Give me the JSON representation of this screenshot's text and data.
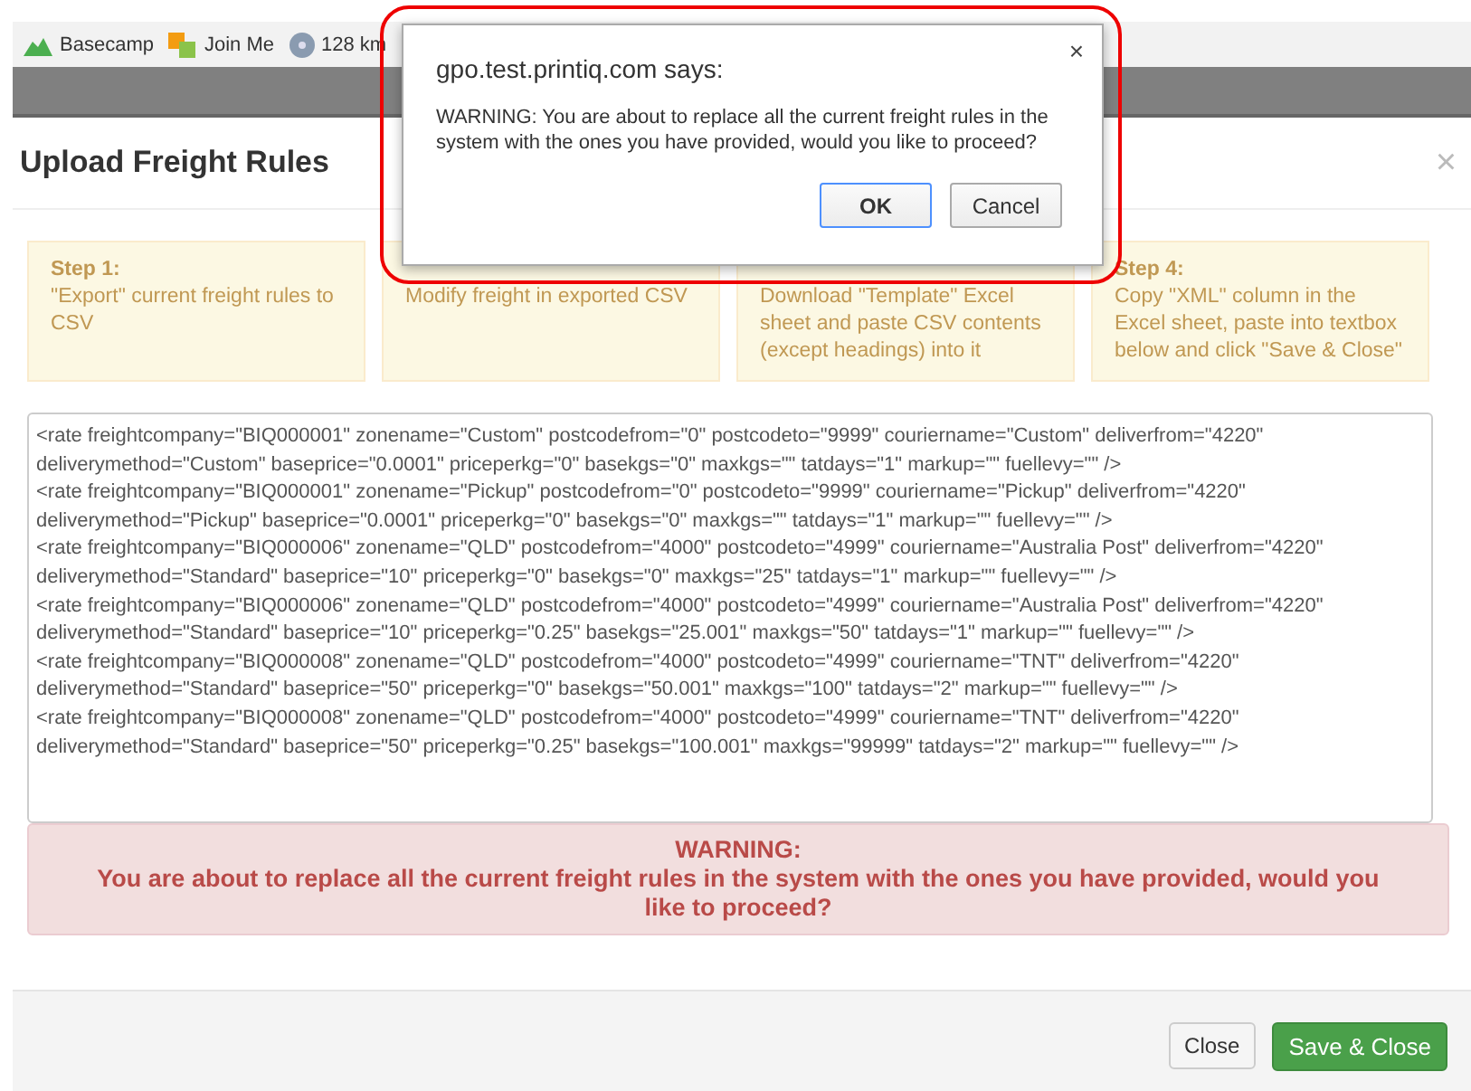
{
  "bookmarks": [
    {
      "label": "Basecamp",
      "kind": "mountain"
    },
    {
      "label": "Join Me",
      "kind": "squares"
    },
    {
      "label": "128 km",
      "kind": "disc"
    }
  ],
  "modal": {
    "title": "Upload Freight Rules",
    "close": "×",
    "steps": [
      {
        "heading": "Step 1:",
        "text": "\"Export\" current freight rules to CSV"
      },
      {
        "text": "Modify freight in exported CSV"
      },
      {
        "text": "Download \"Template\" Excel sheet and paste CSV contents (except headings) into it"
      },
      {
        "heading": "Step 4:",
        "text": "Copy \"XML\" column in the Excel sheet, paste into textbox below and click \"Save & Close\""
      }
    ],
    "xml_lines": [
      "<rate freightcompany=\"BIQ000001\" zonename=\"Custom\" postcodefrom=\"0\" postcodeto=\"9999\" couriername=\"Custom\" deliverfrom=\"4220\"",
      "deliverymethod=\"Custom\" baseprice=\"0.0001\" priceperkg=\"0\" basekgs=\"0\" maxkgs=\"\" tatdays=\"1\" markup=\"\" fuellevy=\"\" />",
      "<rate freightcompany=\"BIQ000001\" zonename=\"Pickup\" postcodefrom=\"0\" postcodeto=\"9999\" couriername=\"Pickup\" deliverfrom=\"4220\"",
      "deliverymethod=\"Pickup\" baseprice=\"0.0001\" priceperkg=\"0\" basekgs=\"0\" maxkgs=\"\" tatdays=\"1\" markup=\"\" fuellevy=\"\" />",
      "<rate freightcompany=\"BIQ000006\" zonename=\"QLD\" postcodefrom=\"4000\" postcodeto=\"4999\" couriername=\"Australia Post\" deliverfrom=\"4220\"",
      "deliverymethod=\"Standard\" baseprice=\"10\" priceperkg=\"0\" basekgs=\"0\" maxkgs=\"25\" tatdays=\"1\" markup=\"\" fuellevy=\"\" />",
      "<rate freightcompany=\"BIQ000006\" zonename=\"QLD\" postcodefrom=\"4000\" postcodeto=\"4999\" couriername=\"Australia Post\" deliverfrom=\"4220\"",
      "deliverymethod=\"Standard\" baseprice=\"10\" priceperkg=\"0.25\" basekgs=\"25.001\" maxkgs=\"50\" tatdays=\"1\" markup=\"\" fuellevy=\"\" />",
      "<rate freightcompany=\"BIQ000008\" zonename=\"QLD\" postcodefrom=\"4000\" postcodeto=\"4999\" couriername=\"TNT\" deliverfrom=\"4220\"",
      "deliverymethod=\"Standard\" baseprice=\"50\" priceperkg=\"0\" basekgs=\"50.001\" maxkgs=\"100\" tatdays=\"2\" markup=\"\" fuellevy=\"\" />",
      "<rate freightcompany=\"BIQ000008\" zonename=\"QLD\" postcodefrom=\"4000\" postcodeto=\"4999\" couriername=\"TNT\" deliverfrom=\"4220\"",
      "deliverymethod=\"Standard\" baseprice=\"50\" priceperkg=\"0.25\" basekgs=\"100.001\" maxkgs=\"99999\" tatdays=\"2\" markup=\"\" fuellevy=\"\" />"
    ],
    "warning": {
      "heading": "WARNING:",
      "text": "You are about to replace all the current freight rules in the system with the ones you have provided, would you like to proceed?"
    },
    "buttons": [
      {
        "label": "Close",
        "kind": "default"
      },
      {
        "label": "Save & Close",
        "kind": "primary"
      }
    ]
  },
  "dialog": {
    "title": "gpo.test.printiq.com says:",
    "close": "×",
    "message": "WARNING: You are about to replace all the current freight rules in the system with the ones you have provided, would you like to proceed?",
    "buttons": [
      {
        "label": "OK",
        "selected": true
      },
      {
        "label": "Cancel",
        "selected": false
      }
    ]
  }
}
